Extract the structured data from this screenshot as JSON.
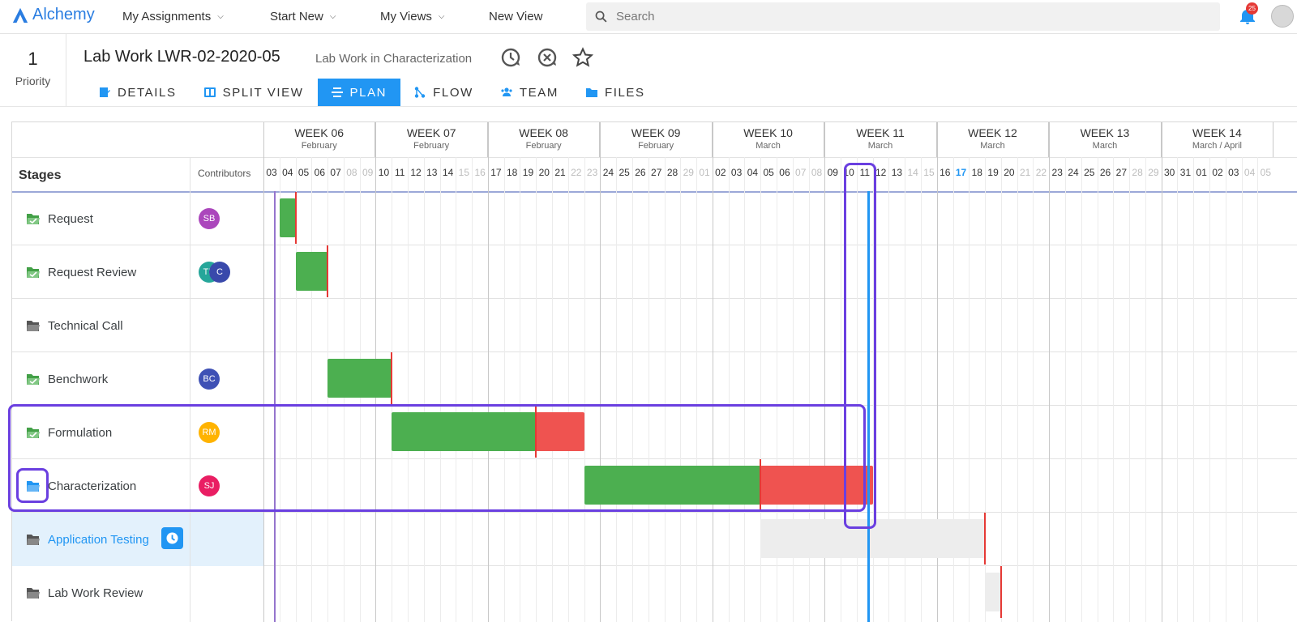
{
  "app": {
    "name": "Alchemy",
    "brand_color": "#2a7de1"
  },
  "nav": {
    "items": [
      "My Assignments",
      "Start New",
      "My Views",
      "New View"
    ],
    "search_placeholder": "Search",
    "notif_count": "25"
  },
  "header": {
    "priority_value": "1",
    "priority_label": "Priority",
    "title": "Lab Work LWR-02-2020-05",
    "subtitle": "Lab Work in Characterization"
  },
  "tabs": [
    {
      "label": "DETAILS",
      "active": false,
      "icon": "details-icon"
    },
    {
      "label": "SPLIT VIEW",
      "active": false,
      "icon": "split-view-icon"
    },
    {
      "label": "PLAN",
      "active": true,
      "icon": "plan-icon"
    },
    {
      "label": "FLOW",
      "active": false,
      "icon": "flow-icon"
    },
    {
      "label": "TEAM",
      "active": false,
      "icon": "team-icon"
    },
    {
      "label": "FILES",
      "active": false,
      "icon": "files-icon"
    }
  ],
  "gantt": {
    "stages_label": "Stages",
    "contributors_label": "Contributors",
    "weeks": [
      {
        "label": "WEEK 06",
        "month": "February"
      },
      {
        "label": "WEEK 07",
        "month": "February"
      },
      {
        "label": "WEEK 08",
        "month": "February"
      },
      {
        "label": "WEEK 09",
        "month": "February"
      },
      {
        "label": "WEEK 10",
        "month": "March"
      },
      {
        "label": "WEEK 11",
        "month": "March"
      },
      {
        "label": "WEEK 12",
        "month": "March"
      },
      {
        "label": "WEEK 13",
        "month": "March"
      },
      {
        "label": "WEEK 14",
        "month": "March / April"
      }
    ],
    "days": [
      "03",
      "04",
      "05",
      "06",
      "07",
      "08",
      "09",
      "10",
      "11",
      "12",
      "13",
      "14",
      "15",
      "16",
      "17",
      "18",
      "19",
      "20",
      "21",
      "22",
      "23",
      "24",
      "25",
      "26",
      "27",
      "28",
      "29",
      "01",
      "02",
      "03",
      "04",
      "05",
      "06",
      "07",
      "08",
      "09",
      "10",
      "11",
      "12",
      "13",
      "14",
      "15",
      "16",
      "17",
      "18",
      "19",
      "20",
      "21",
      "22",
      "23",
      "24",
      "25",
      "26",
      "27",
      "28",
      "29",
      "30",
      "31",
      "01",
      "02",
      "03",
      "04",
      "05"
    ],
    "today_day_index": 43,
    "stages": [
      {
        "name": "Request",
        "status": "done",
        "contributors": [
          {
            "initials": "SB",
            "color": "#ab47bc"
          }
        ],
        "bar": {
          "start": 1,
          "plan_end": 2,
          "end": 2
        }
      },
      {
        "name": "Request Review",
        "status": "done",
        "contributors": [
          {
            "initials": "TD",
            "color": "#26a69a"
          },
          {
            "initials": "C",
            "color": "#3949ab"
          }
        ],
        "bar": {
          "start": 2,
          "plan_end": 4,
          "end": 4
        }
      },
      {
        "name": "Technical Call",
        "status": "skipped",
        "contributors": [],
        "bar": null
      },
      {
        "name": "Benchwork",
        "status": "done",
        "contributors": [
          {
            "initials": "BC",
            "color": "#3f51b5"
          }
        ],
        "bar": {
          "start": 4,
          "plan_end": 8,
          "end": 8
        }
      },
      {
        "name": "Formulation",
        "status": "done",
        "contributors": [
          {
            "initials": "RM",
            "color": "#ffb300"
          }
        ],
        "bar": {
          "start": 8,
          "plan_end": 17,
          "end": 20
        }
      },
      {
        "name": "Characterization",
        "status": "active",
        "contributors": [
          {
            "initials": "SJ",
            "color": "#e91e63"
          }
        ],
        "bar": {
          "start": 20,
          "plan_end": 31,
          "end": 38
        }
      },
      {
        "name": "Application Testing",
        "status": "upcoming",
        "selected": true,
        "contributors": [],
        "bar": {
          "start": 31,
          "plan_end": 45,
          "end": 45
        }
      },
      {
        "name": "Lab Work Review",
        "status": "upcoming",
        "contributors": [],
        "bar": {
          "start": 45,
          "plan_end": 46,
          "end": 46
        }
      }
    ]
  }
}
